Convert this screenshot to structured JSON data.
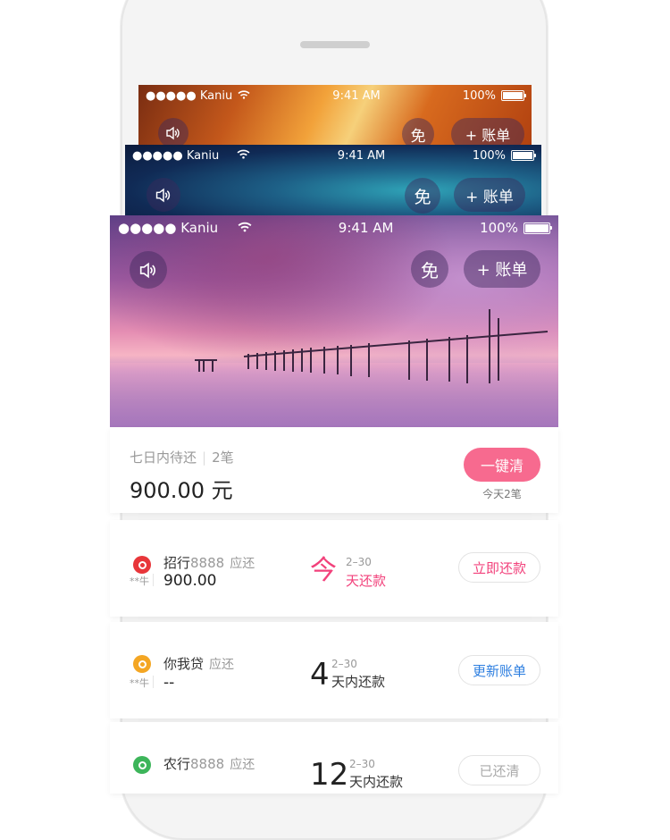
{
  "status_bar": {
    "carrier": "●●●●● Kaniu",
    "time": "9:41 AM",
    "battery": "100%"
  },
  "header": {
    "free_label": "免",
    "add_bill_label": "+ 账单"
  },
  "summary": {
    "label": "七日内待还",
    "count": "2笔",
    "amount": "900.00 元",
    "button": "一键清",
    "sub": "今天2笔"
  },
  "loans": [
    {
      "bank": "招行",
      "number": "8888",
      "tag": "应还",
      "owner": "**牛",
      "amount": "900.00",
      "big": "今",
      "date": "2–30",
      "due": "天还款",
      "action": "立即还款",
      "logo_color": "#e8363a",
      "action_color": "#f2417b"
    },
    {
      "bank": "你我贷",
      "number": "",
      "tag": "应还",
      "owner": "**牛",
      "amount": "--",
      "big": "4",
      "date": "2–30",
      "due": "天内还款",
      "action": "更新账单",
      "logo_color": "#f4a623",
      "action_color": "#2e7fe0"
    },
    {
      "bank": "农行",
      "number": "8888",
      "tag": "应还",
      "owner": "",
      "amount": "",
      "big": "12",
      "date": "2–30",
      "due": "天内还款",
      "action": "已还清",
      "logo_color": "#3db55a",
      "action_color": "#aaaaaa"
    }
  ]
}
